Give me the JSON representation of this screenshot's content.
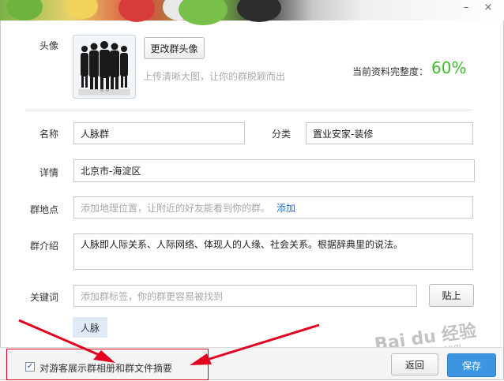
{
  "window": {
    "minimize": "–",
    "close": "×"
  },
  "avatar": {
    "label": "头像",
    "change_button": "更改群头像",
    "hint": "上传清晰大图，让你的群脱颖而出"
  },
  "completeness": {
    "label": "当前资料完整度：",
    "value": "60%"
  },
  "fields": {
    "name": {
      "label": "名称",
      "value": "人脉群"
    },
    "category": {
      "label": "分类",
      "value": "置业安家-装修"
    },
    "detail": {
      "label": "详情",
      "value": "北京市-海淀区"
    },
    "location": {
      "label": "群地点",
      "placeholder": "添加地理位置，让附近的好友能看到你的群。",
      "add_link": "添加"
    },
    "intro": {
      "label": "群介绍",
      "value": "人脉即人际关系、人际网络、体现人的人缘、社会关系。根据辞典里的说法。"
    },
    "keywords": {
      "label": "关键词",
      "placeholder": "添加群标签，你的群更容易被找到",
      "paste_button": "贴上"
    }
  },
  "tags": [
    "人脉"
  ],
  "footer": {
    "checkbox_label": "对游客展示群相册和群文件摘要",
    "checked": true,
    "back_button": "返回",
    "save_button": "保存"
  },
  "watermark": {
    "text": "Bai du 经验",
    "sub": "jingyan.baidu.com"
  },
  "colors": {
    "completeness": "#3dbb2b",
    "link": "#2673c8",
    "annotation": "#e1001e",
    "save_bg": "#3c95e0"
  }
}
